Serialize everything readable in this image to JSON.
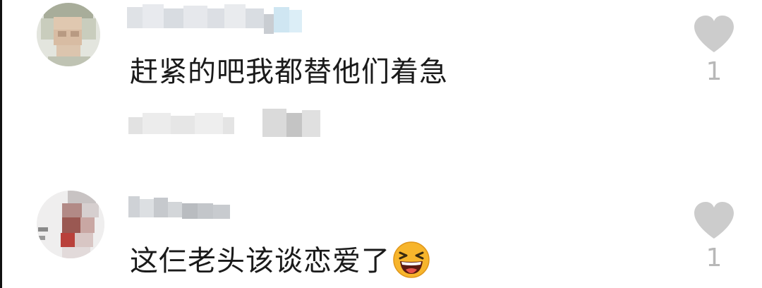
{
  "comments": [
    {
      "text": "赶紧的吧我都替他们着急",
      "like_count": "1",
      "heart_color": "#cccccc"
    },
    {
      "text": "这仨老头该谈恋爱了",
      "like_count": "1",
      "emoji": "laughing-face-icon",
      "heart_color": "#cccccc"
    }
  ]
}
